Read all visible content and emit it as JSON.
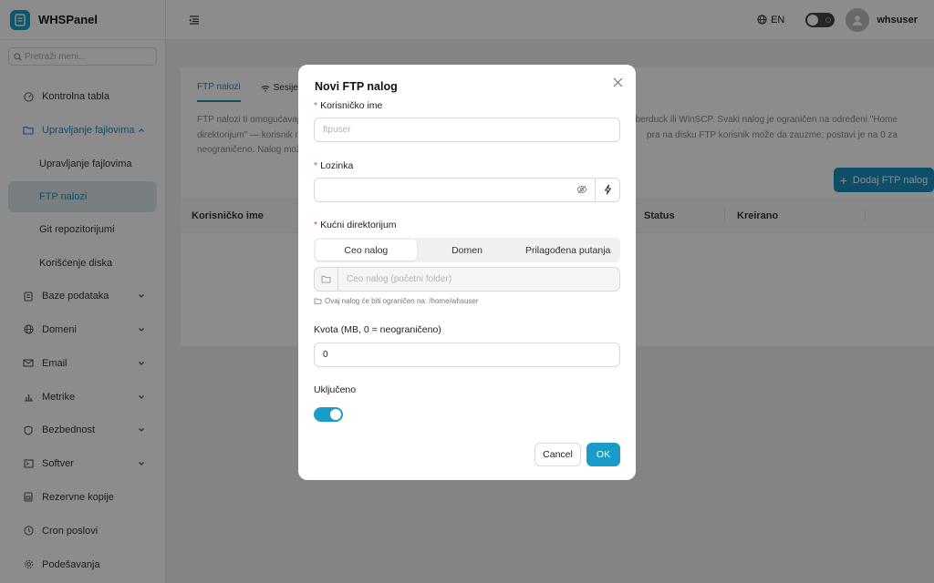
{
  "brand": {
    "name": "WHSPanel",
    "icon": "panel-logo-icon"
  },
  "sidebar": {
    "search_placeholder": "Pretraži meni...",
    "items": [
      {
        "label": "Kontrolna tabla",
        "icon": "dashboard-icon"
      },
      {
        "label": "Upravljanje fajlovima",
        "icon": "folder-icon",
        "open": true,
        "children": [
          {
            "label": "Upravljanje fajlovima"
          },
          {
            "label": "FTP nalozi",
            "active": true
          },
          {
            "label": "Git repozitorijumi"
          },
          {
            "label": "Korišćenje diska"
          }
        ]
      },
      {
        "label": "Baze podataka",
        "icon": "database-icon"
      },
      {
        "label": "Domeni",
        "icon": "globe-icon"
      },
      {
        "label": "Email",
        "icon": "mail-icon"
      },
      {
        "label": "Metrike",
        "icon": "bar-chart-icon"
      },
      {
        "label": "Bezbednost",
        "icon": "shield-icon"
      },
      {
        "label": "Softver",
        "icon": "terminal-icon"
      },
      {
        "label": "Rezervne kopije",
        "icon": "backup-icon"
      },
      {
        "label": "Cron poslovi",
        "icon": "clock-icon"
      },
      {
        "label": "Podešavanja",
        "icon": "gear-icon"
      }
    ]
  },
  "header": {
    "lang": "EN",
    "username": "whsuser"
  },
  "main": {
    "tabs": [
      {
        "label": "FTP nalozi"
      },
      {
        "label": "Sesije"
      }
    ],
    "description_line1": "FTP nalozi ti omogućavaju",
    "description_line1_right": "berduck ili WinSCP. Svaki nalog je ograničen na određeni \"Home",
    "description_line2": "direktorijum\" — korisnik n",
    "description_line2_right": "pra na disku FTP korisnik može da zauzme; postavi je na 0 za",
    "description_line3": "neograničeno. Nalog mož",
    "add_button": "Dodaj FTP nalog",
    "columns": [
      "Korisničko ime",
      "Status",
      "Kreirano"
    ]
  },
  "modal": {
    "title": "Novi FTP nalog",
    "username_label": "Korisničko ime",
    "username_placeholder": "ftpuser",
    "password_label": "Lozinka",
    "home_label": "Kućni direktorijum",
    "home_options": [
      "Ceo nalog",
      "Domen",
      "Prilagođena putanja"
    ],
    "home_selected": "Ceo nalog",
    "home_placeholder": "Ceo nalog (početni folder)",
    "home_hint": "Ovaj nalog će biti ograničen na: /home/whsuser",
    "quota_label": "Kvota (MB, 0 = neograničeno)",
    "quota_value": "0",
    "enabled_label": "Uključeno",
    "enabled": true,
    "cancel": "Cancel",
    "ok": "OK"
  },
  "colors": {
    "accent": "#1a9bc8",
    "required": "#e24a4a"
  }
}
